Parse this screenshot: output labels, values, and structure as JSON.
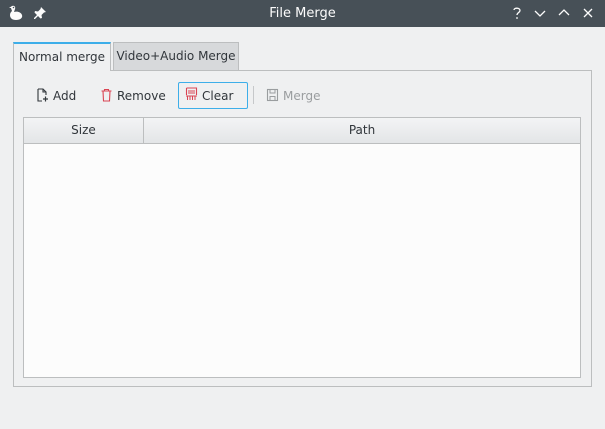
{
  "window": {
    "title": "File Merge",
    "icons": [
      "duck-app-icon",
      "pin-icon",
      "help-icon",
      "minimize-icon",
      "maximize-icon",
      "close-icon"
    ],
    "help_label": "?"
  },
  "tabs": [
    {
      "label": "Normal merge",
      "active": true
    },
    {
      "label": "Video+Audio Merge",
      "active": false
    }
  ],
  "toolbar": {
    "add_label": "Add",
    "remove_label": "Remove",
    "clear_label": "Clear",
    "merge_label": "Merge"
  },
  "table": {
    "columns": [
      "Size",
      "Path"
    ],
    "rows": []
  },
  "colors": {
    "titlebar": "#475057",
    "accent": "#3daee9",
    "remove_icon": "#da4453"
  }
}
